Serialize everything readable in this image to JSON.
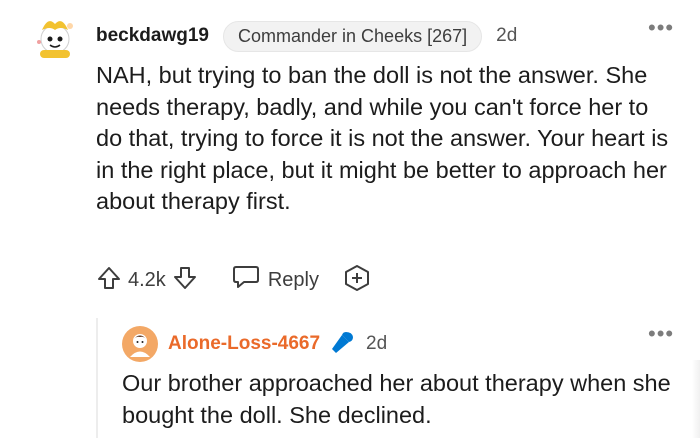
{
  "comment": {
    "username": "beckdawg19",
    "flair": "Commander in Cheeks [267]",
    "timestamp": "2d",
    "more_label": "•••",
    "body": "NAH, but trying to ban the doll is not the answer. She needs therapy, badly, and while you can't force her to do that, trying to force it is not the answer. Your heart is in the right place, but it might be better to approach her about therapy first.",
    "score": "4.2k",
    "reply_label": "Reply",
    "icons": {
      "avatar": "snoo-avatar-icon",
      "upvote": "upvote-arrow-icon",
      "downvote": "downvote-arrow-icon",
      "reply": "speech-bubble-icon",
      "award": "award-plus-icon",
      "more": "more-dots-icon"
    }
  },
  "reply": {
    "username": "Alone-Loss-4667",
    "timestamp": "2d",
    "more_label": "•••",
    "body": "Our brother approached her about therapy when she bought the doll. She declined.",
    "icons": {
      "avatar": "user-avatar-icon",
      "badge": "microphone-icon"
    }
  },
  "colors": {
    "text": "#1c1c1c",
    "muted": "#7c7c7c",
    "reply_username": "#ea6a2a",
    "mic_badge": "#0079d3"
  }
}
